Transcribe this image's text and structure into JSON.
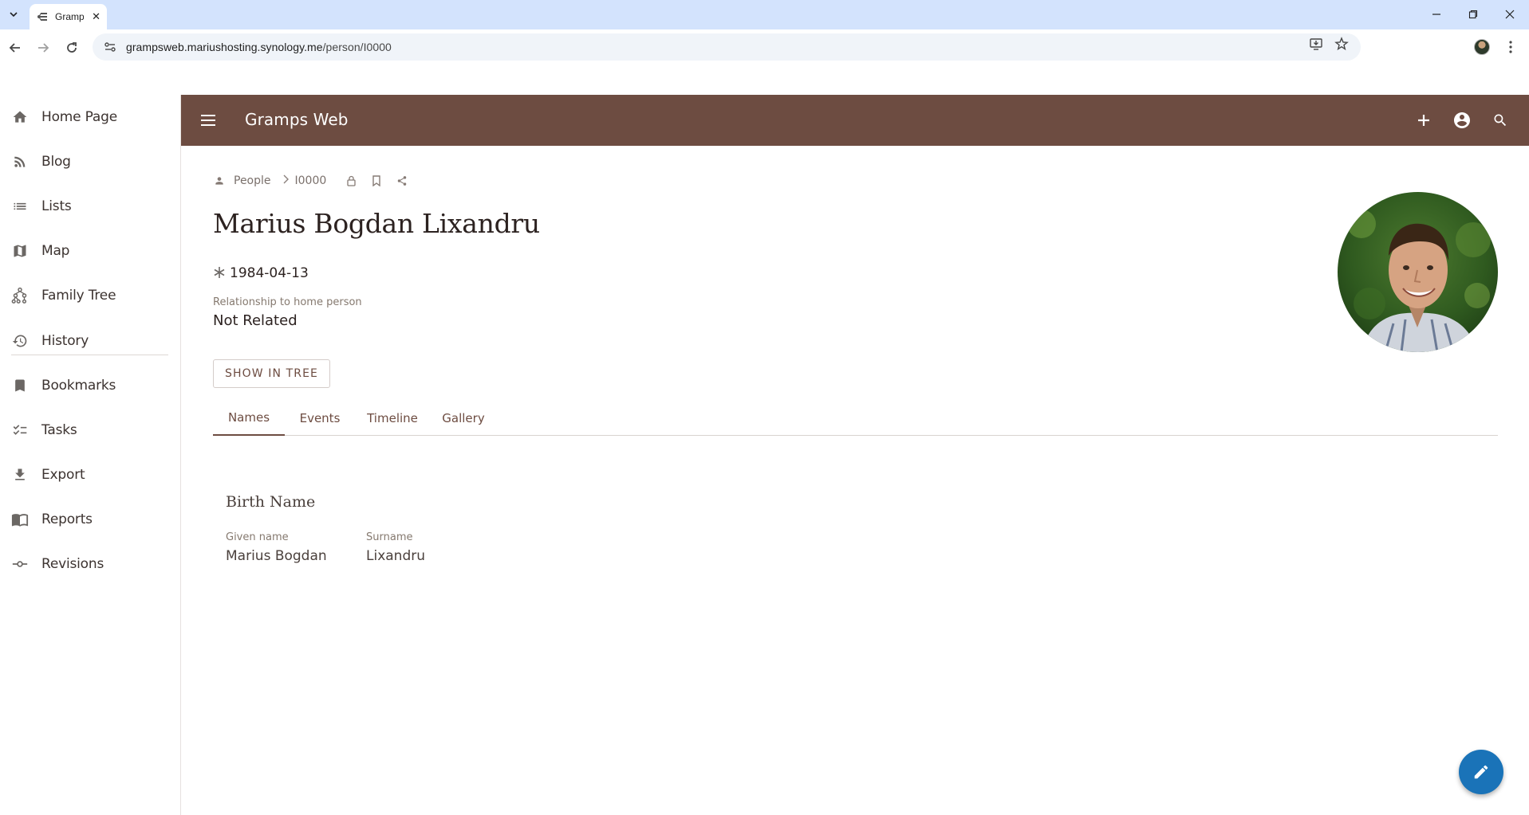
{
  "browser": {
    "tab_title": "Gramps Web",
    "url_host": "grampsweb.mariushosting.synology.me",
    "url_path": "/person/I0000"
  },
  "app": {
    "brand": "Gramps Web"
  },
  "drawer": {
    "items": [
      {
        "label": "Home Page",
        "icon": "home-icon"
      },
      {
        "label": "Blog",
        "icon": "rss-icon"
      },
      {
        "label": "Lists",
        "icon": "list-icon"
      },
      {
        "label": "Map",
        "icon": "map-icon"
      },
      {
        "label": "Family Tree",
        "icon": "family-tree-icon"
      },
      {
        "label": "History",
        "icon": "history-icon"
      },
      {
        "label": "Bookmarks",
        "icon": "bookmark-icon"
      },
      {
        "label": "Tasks",
        "icon": "tasks-icon"
      },
      {
        "label": "Export",
        "icon": "download-icon"
      },
      {
        "label": "Reports",
        "icon": "reports-icon"
      },
      {
        "label": "Revisions",
        "icon": "commit-icon"
      }
    ]
  },
  "breadcrumb": {
    "section": "People",
    "id": "I0000"
  },
  "person": {
    "name": "Marius Bogdan Lixandru",
    "birth_date": "1984-04-13",
    "relationship_label": "Relationship to home person",
    "relationship_value": "Not Related",
    "show_in_tree": "SHOW IN TREE"
  },
  "tabs": [
    "Names",
    "Events",
    "Timeline",
    "Gallery"
  ],
  "names": {
    "section_title": "Birth Name",
    "given_label": "Given name",
    "given_value": "Marius Bogdan",
    "surname_label": "Surname",
    "surname_value": "Lixandru"
  },
  "colors": {
    "brand": "#6d4c41",
    "fab": "#1a73b8",
    "browser_frame": "#d3e3fd"
  }
}
